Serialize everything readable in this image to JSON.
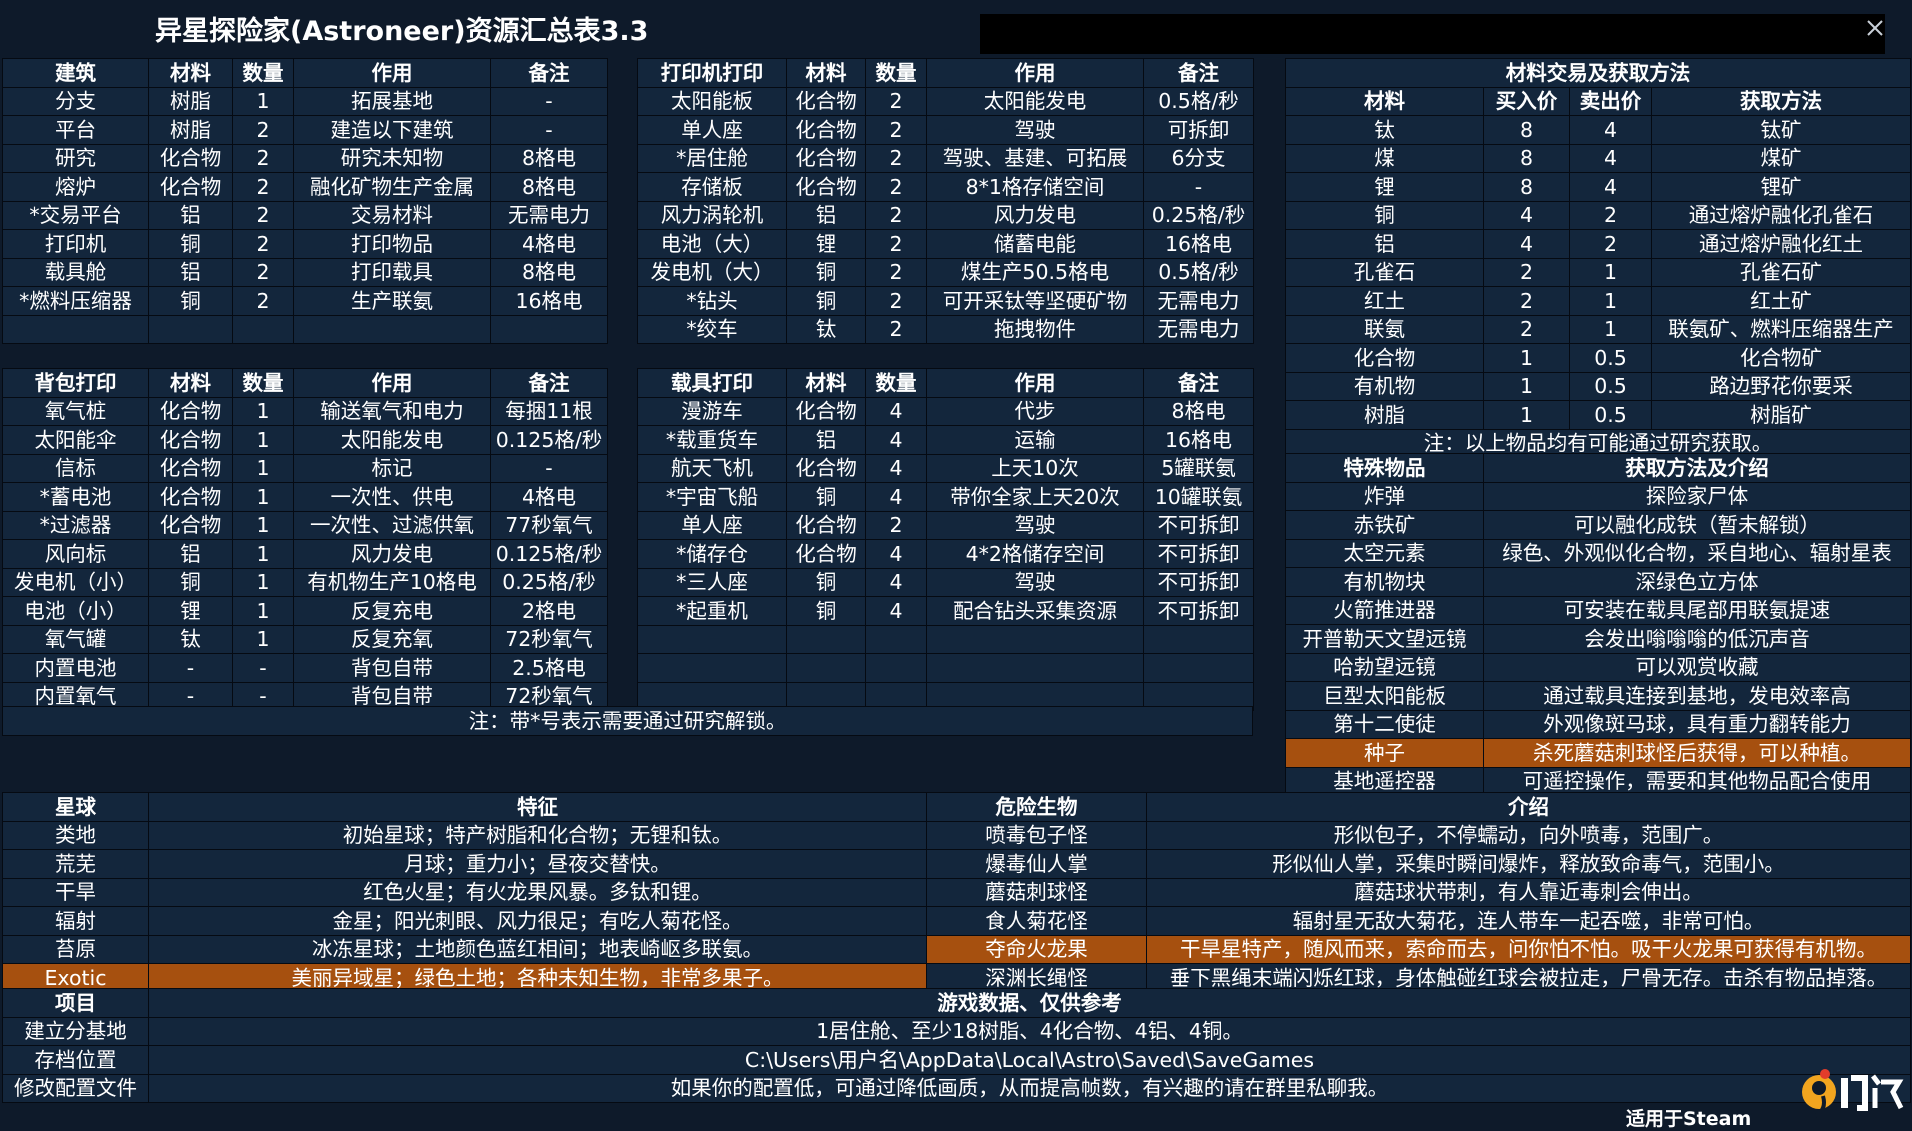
{
  "title": "异星探险家(Astroneer)资源汇总表3.3",
  "footer": "适用于Steam",
  "logo_text": "九游",
  "colors": {
    "background": "#0e1a2a",
    "cell": "#13263c",
    "highlight": "#a6500f"
  },
  "buildings": {
    "headers": [
      "建筑",
      "材料",
      "数量",
      "作用",
      "备注"
    ],
    "rows": [
      [
        "分支",
        "树脂",
        "1",
        "拓展基地",
        "-"
      ],
      [
        "平台",
        "树脂",
        "2",
        "建造以下建筑",
        "-"
      ],
      [
        "研究",
        "化合物",
        "2",
        "研究未知物",
        "8格电"
      ],
      [
        "熔炉",
        "化合物",
        "2",
        "融化矿物生产金属",
        "8格电"
      ],
      [
        "*交易平台",
        "铝",
        "2",
        "交易材料",
        "无需电力"
      ],
      [
        "打印机",
        "铜",
        "2",
        "打印物品",
        "4格电"
      ],
      [
        "载具舱",
        "铝",
        "2",
        "打印载具",
        "8格电"
      ],
      [
        "*燃料压缩器",
        "铜",
        "2",
        "生产联氨",
        "16格电"
      ],
      [
        "",
        "",
        "",
        "",
        ""
      ]
    ]
  },
  "printer": {
    "headers": [
      "打印机打印",
      "材料",
      "数量",
      "作用",
      "备注"
    ],
    "rows": [
      [
        "太阳能板",
        "化合物",
        "2",
        "太阳能发电",
        "0.5格/秒"
      ],
      [
        "单人座",
        "化合物",
        "2",
        "驾驶",
        "可拆卸"
      ],
      [
        "*居住舱",
        "化合物",
        "2",
        "驾驶、基建、可拓展",
        "6分支"
      ],
      [
        "存储板",
        "化合物",
        "2",
        "8*1格存储空间",
        "-"
      ],
      [
        "风力涡轮机",
        "铝",
        "2",
        "风力发电",
        "0.25格/秒"
      ],
      [
        "电池（大）",
        "锂",
        "2",
        "储蓄电能",
        "16格电"
      ],
      [
        "发电机（大）",
        "铜",
        "2",
        "煤生产50.5格电",
        "0.5格/秒"
      ],
      [
        "*钻头",
        "铜",
        "2",
        "可开采钛等坚硬矿物",
        "无需电力"
      ],
      [
        "*绞车",
        "钛",
        "2",
        "拖拽物件",
        "无需电力"
      ]
    ]
  },
  "backpack": {
    "headers": [
      "背包打印",
      "材料",
      "数量",
      "作用",
      "备注"
    ],
    "rows": [
      [
        "氧气桩",
        "化合物",
        "1",
        "输送氧气和电力",
        "每捆11根"
      ],
      [
        "太阳能伞",
        "化合物",
        "1",
        "太阳能发电",
        "0.125格/秒"
      ],
      [
        "信标",
        "化合物",
        "1",
        "标记",
        "-"
      ],
      [
        "*蓄电池",
        "化合物",
        "1",
        "一次性、供电",
        "4格电"
      ],
      [
        "*过滤器",
        "化合物",
        "1",
        "一次性、过滤供氧",
        "77秒氧气"
      ],
      [
        "风向标",
        "铝",
        "1",
        "风力发电",
        "0.125格/秒"
      ],
      [
        "发电机（小）",
        "铜",
        "1",
        "有机物生产10格电",
        "0.25格/秒"
      ],
      [
        "电池（小）",
        "锂",
        "1",
        "反复充电",
        "2格电"
      ],
      [
        "氧气罐",
        "钛",
        "1",
        "反复充氧",
        "72秒氧气"
      ],
      [
        "内置电池",
        "-",
        "-",
        "背包自带",
        "2.5格电"
      ],
      [
        "内置氧气",
        "-",
        "-",
        "背包自带",
        "72秒氧气"
      ]
    ]
  },
  "vehicle": {
    "headers": [
      "载具打印",
      "材料",
      "数量",
      "作用",
      "备注"
    ],
    "rows": [
      [
        "漫游车",
        "化合物",
        "4",
        "代步",
        "8格电"
      ],
      [
        "*载重货车",
        "铝",
        "4",
        "运输",
        "16格电"
      ],
      [
        "航天飞机",
        "化合物",
        "4",
        "上天10次",
        "5罐联氨"
      ],
      [
        "*宇宙飞船",
        "铜",
        "4",
        "带你全家上天20次",
        "10罐联氨"
      ],
      [
        "单人座",
        "化合物",
        "2",
        "驾驶",
        "不可拆卸"
      ],
      [
        "*储存仓",
        "化合物",
        "4",
        "4*2格储存空间",
        "不可拆卸"
      ],
      [
        "*三人座",
        "铜",
        "4",
        "驾驶",
        "不可拆卸"
      ],
      [
        "*起重机",
        "铜",
        "4",
        "配合钻头采集资源",
        "不可拆卸"
      ],
      [
        "",
        "",
        "",
        "",
        ""
      ],
      [
        "",
        "",
        "",
        "",
        ""
      ],
      [
        "",
        "",
        "",
        "",
        ""
      ]
    ]
  },
  "unlock_note": "注：带*号表示需要通过研究解锁。",
  "trade": {
    "title": "材料交易及获取方法",
    "headers": [
      "材料",
      "买入价",
      "卖出价",
      "获取方法"
    ],
    "rows": [
      [
        "钛",
        "8",
        "4",
        "钛矿"
      ],
      [
        "煤",
        "8",
        "4",
        "煤矿"
      ],
      [
        "锂",
        "8",
        "4",
        "锂矿"
      ],
      [
        "铜",
        "4",
        "2",
        "通过熔炉融化孔雀石"
      ],
      [
        "铝",
        "4",
        "2",
        "通过熔炉融化红土"
      ],
      [
        "孔雀石",
        "2",
        "1",
        "孔雀石矿"
      ],
      [
        "红土",
        "2",
        "1",
        "红土矿"
      ],
      [
        "联氨",
        "2",
        "1",
        "联氨矿、燃料压缩器生产"
      ],
      [
        "化合物",
        "1",
        "0.5",
        "化合物矿"
      ],
      [
        "有机物",
        "1",
        "0.5",
        "路边野花你要采"
      ],
      [
        "树脂",
        "1",
        "0.5",
        "树脂矿"
      ]
    ],
    "note": "注：以上物品均有可能通过研究获取。"
  },
  "special": {
    "headers": [
      "特殊物品",
      "获取方法及介绍"
    ],
    "rows": [
      [
        "炸弹",
        "探险家尸体"
      ],
      [
        "赤铁矿",
        "可以融化成铁（暂未解锁）"
      ],
      [
        "太空元素",
        "绿色、外观似化合物，采自地心、辐射星表"
      ],
      [
        "有机物块",
        "深绿色立方体"
      ],
      [
        "火箭推进器",
        "可安装在载具尾部用联氨提速"
      ],
      [
        "开普勒天文望远镜",
        "会发出嗡嗡嗡的低沉声音"
      ],
      [
        "哈勃望远镜",
        "可以观赏收藏"
      ],
      [
        "巨型太阳能板",
        "通过载具连接到基地，发电效率高"
      ],
      [
        "第十二使徒",
        "外观像斑马球，具有重力翻转能力"
      ],
      [
        "种子",
        "杀死蘑菇刺球怪后获得，可以种植。"
      ],
      [
        "基地遥控器",
        "可遥控操作，需要和其他物品配合使用"
      ]
    ]
  },
  "planets": {
    "headers": [
      "星球",
      "特征"
    ],
    "rows": [
      [
        "类地",
        "初始星球；特产树脂和化合物；无锂和钛。"
      ],
      [
        "荒芜",
        "月球；重力小；昼夜交替快。"
      ],
      [
        "干旱",
        "红色火星；有火龙果风暴。多钛和锂。"
      ],
      [
        "辐射",
        "金星；阳光刺眼、风力很足；有吃人菊花怪。"
      ],
      [
        "苔原",
        "冰冻星球；土地颜色蓝红相间；地表崎岖多联氨。"
      ],
      [
        "Exotic",
        "美丽异域星；绿色土地；各种未知生物，非常多果子。"
      ]
    ]
  },
  "creatures": {
    "headers": [
      "危险生物",
      "介绍"
    ],
    "rows": [
      [
        "喷毒包子怪",
        "形似包子，不停蠕动，向外喷毒，范围广。"
      ],
      [
        "爆毒仙人掌",
        "形似仙人掌，采集时瞬间爆炸，释放致命毒气，范围小。"
      ],
      [
        "蘑菇刺球怪",
        "蘑菇球状带刺，有人靠近毒刺会伸出。"
      ],
      [
        "食人菊花怪",
        "辐射星无敌大菊花，连人带车一起吞噬，非常可怕。"
      ],
      [
        "夺命火龙果",
        "干旱星特产，随风而来，索命而去，问你怕不怕。吸干火龙果可获得有机物。"
      ],
      [
        "深渊长绳怪",
        "垂下黑绳末端闪烁红球，身体触碰红球会被拉走，尸骨无存。击杀有物品掉落。"
      ]
    ]
  },
  "game_data": {
    "headers": [
      "项目",
      "游戏数据、仅供参考"
    ],
    "rows": [
      [
        "建立分基地",
        "1居住舱、至少18树脂、4化合物、4铝、4铜。"
      ],
      [
        "存档位置",
        "C:\\Users\\用户名\\AppData\\Local\\Astro\\Saved\\SaveGames"
      ],
      [
        "修改配置文件",
        "如果你的配置低，可通过降低画质，从而提高帧数，有兴趣的请在群里私聊我。"
      ]
    ]
  }
}
